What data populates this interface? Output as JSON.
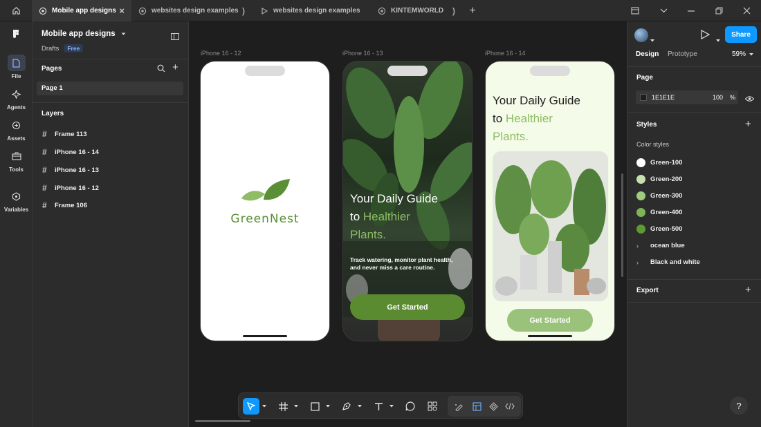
{
  "tabs": [
    {
      "label": "Mobile app designs",
      "icon": "figma-file-icon",
      "active": true
    },
    {
      "label": "websites design examples",
      "icon": "figma-file-icon",
      "active": false
    },
    {
      "label": "websites design examples",
      "icon": "play-icon",
      "active": false
    },
    {
      "label": "KINTEMWORLD",
      "icon": "figma-file-icon",
      "active": false
    }
  ],
  "rail": {
    "file": "File",
    "agents": "Agents",
    "assets": "Assets",
    "tools": "Tools",
    "variables": "Variables"
  },
  "left": {
    "file_name": "Mobile app designs",
    "drafts": "Drafts",
    "plan_badge": "Free",
    "pages_title": "Pages",
    "page_item": "Page 1",
    "layers_title": "Layers",
    "layers": [
      "Frame 113",
      "iPhone 16 - 14",
      "iPhone 16 - 13",
      "iPhone 16 - 12",
      "Frame 106"
    ]
  },
  "canvas": {
    "frames": [
      {
        "label": "iPhone 16 - 12"
      },
      {
        "label": "iPhone 16 - 13"
      },
      {
        "label": "iPhone 16 - 14"
      }
    ],
    "brand": "GreenNest",
    "headline_1": "Your Daily Guide",
    "headline_2a": "to ",
    "headline_2b": "Healthier",
    "headline_3": "Plants.",
    "subtext_1": "Track watering, monitor plant health,",
    "subtext_2": "and never miss a care routine.",
    "cta": "Get Started"
  },
  "right": {
    "design_tab": "Design",
    "prototype_tab": "Prototype",
    "zoom": "59%",
    "share": "Share",
    "page_title": "Page",
    "page_color": "1E1E1E",
    "page_opacity": "100",
    "percent": "%",
    "styles_title": "Styles",
    "color_styles_title": "Color styles",
    "color_styles": [
      {
        "name": "Green-100",
        "color": "#ffffff"
      },
      {
        "name": "Green-200",
        "color": "#c8dfb0"
      },
      {
        "name": "Green-300",
        "color": "#9fcb7e"
      },
      {
        "name": "Green-400",
        "color": "#7fb559"
      },
      {
        "name": "Green-500",
        "color": "#5e9934"
      }
    ],
    "groups": [
      "ocean blue",
      "Black and white"
    ],
    "export_title": "Export"
  },
  "colors": {
    "accent_blue": "#0d99ff",
    "brand_green": "#5a8f36",
    "light_green": "#8fbc64",
    "cta_dark": "#5b8b30",
    "cta_light": "#9bc27a"
  }
}
